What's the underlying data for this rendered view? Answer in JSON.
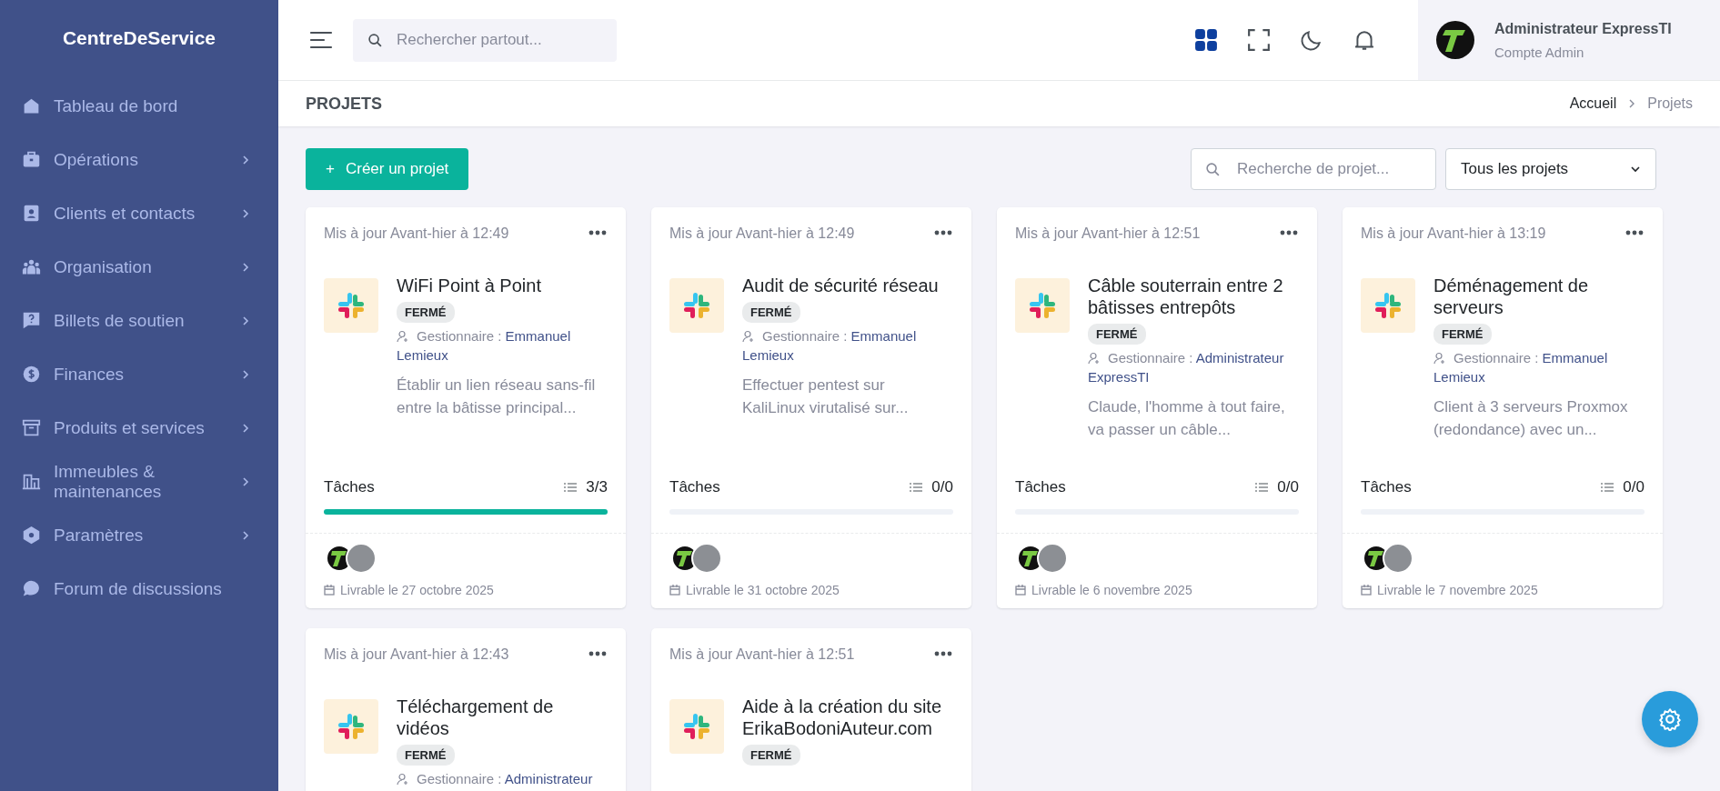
{
  "sidebar": {
    "brand": "CentreDeService",
    "items": [
      {
        "label": "Tableau de bord",
        "kind": "home",
        "has_submenu": false
      },
      {
        "label": "Opérations",
        "kind": "briefcase",
        "has_submenu": true
      },
      {
        "label": "Clients et contacts",
        "kind": "contact",
        "has_submenu": true
      },
      {
        "label": "Organisation",
        "kind": "people",
        "has_submenu": true
      },
      {
        "label": "Billets de soutien",
        "kind": "ticket",
        "has_submenu": true
      },
      {
        "label": "Finances",
        "kind": "money",
        "has_submenu": true
      },
      {
        "label": "Produits et services",
        "kind": "archive",
        "has_submenu": true
      },
      {
        "label": "Immeubles & maintenances",
        "kind": "building",
        "has_submenu": true
      },
      {
        "label": "Paramètres",
        "kind": "hexagon",
        "has_submenu": true
      },
      {
        "label": "Forum de discussions",
        "kind": "chat",
        "has_submenu": false
      }
    ]
  },
  "topbar": {
    "search_placeholder": "Rechercher partout...",
    "user_name": "Administrateur ExpressTI",
    "user_role": "Compte Admin"
  },
  "page_header": {
    "title": "PROJETS",
    "breadcrumb": [
      "Accueil",
      "Projets"
    ]
  },
  "toolbar": {
    "create_button": "Créer un projet",
    "create_icon": "+",
    "search_placeholder": "Recherche de projet...",
    "filter": "Tous les projets"
  },
  "projects": [
    {
      "updated": "Mis à jour Avant-hier à 12:49",
      "title": "WiFi Point à Point",
      "status": "FERMÉ",
      "manager_label": "Gestionnaire :",
      "manager": "Emmanuel Lemieux",
      "description": "Établir un lien réseau sans-fil entre la bâtisse principal...",
      "tasks_label": "Tâches",
      "tasks_count": "3/3",
      "level": 1,
      "members": [
        {
          "kind": "logo"
        },
        {
          "kind": "photo"
        }
      ],
      "deliverable": "Livrable le 27 octobre 2025"
    },
    {
      "updated": "Mis à jour Avant-hier à 12:49",
      "title": "Audit de sécurité réseau",
      "status": "FERMÉ",
      "manager_label": "Gestionnaire :",
      "manager": "Emmanuel Lemieux",
      "description": "Effectuer pentest sur KaliLinux virutalisé sur...",
      "tasks_label": "Tâches",
      "tasks_count": "0/0",
      "level": 0,
      "members": [
        {
          "kind": "logo"
        },
        {
          "kind": "photo"
        }
      ],
      "deliverable": "Livrable le 31 octobre 2025"
    },
    {
      "updated": "Mis à jour Avant-hier à 12:51",
      "title": "Câble souterrain entre 2 bâtisses entrepôts",
      "status": "FERMÉ",
      "manager_label": "Gestionnaire :",
      "manager": "Administrateur ExpressTI",
      "description": "Claude, l'homme à tout faire, va passer un câble...",
      "tasks_label": "Tâches",
      "tasks_count": "0/0",
      "level": 0,
      "members": [
        {
          "kind": "logo"
        },
        {
          "kind": "photo"
        }
      ],
      "deliverable": "Livrable le 6 novembre 2025"
    },
    {
      "updated": "Mis à jour Avant-hier à 13:19",
      "title": "Déménagement de serveurs",
      "status": "FERMÉ",
      "manager_label": "Gestionnaire :",
      "manager": "Emmanuel Lemieux",
      "description": "Client à 3 serveurs Proxmox (redondance) avec un...",
      "tasks_label": "Tâches",
      "tasks_count": "0/0",
      "level": 0,
      "members": [
        {
          "kind": "logo"
        },
        {
          "kind": "photo"
        }
      ],
      "deliverable": "Livrable le 7 novembre 2025"
    },
    {
      "updated": "Mis à jour Avant-hier à 12:43",
      "title": "Téléchargement de vidéos",
      "status": "FERMÉ",
      "manager_label": "Gestionnaire :",
      "manager": "Administrateur"
    },
    {
      "updated": "Mis à jour Avant-hier à 12:51",
      "title": "Aide à la création du site ErikaBodoniAuteur.com",
      "status": "FERMÉ"
    }
  ]
}
